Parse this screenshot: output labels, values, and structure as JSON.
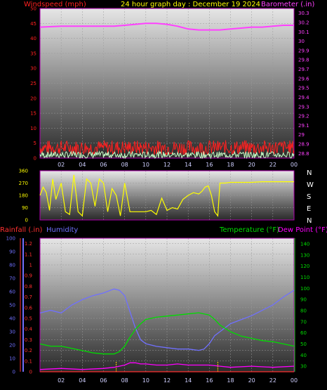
{
  "colors": {
    "wind": "#ff2020",
    "windAvg": "#c8ffc8",
    "barometer": "#ff40ff",
    "direction": "#ffff00",
    "rainfall": "#ff3030",
    "humidity": "#7070ff",
    "temperature": "#00dd00",
    "dewpoint": "#ff00ff",
    "title": "#ffff00"
  },
  "chart_data": [
    {
      "type": "line",
      "title": "24 hour graph day : December 19 2024",
      "ylabel_left": "Windspeed (mph)",
      "ylabel_right": "Barometer (.in)",
      "left_ticks": [
        "50",
        "45",
        "40",
        "35",
        "30",
        "25",
        "20",
        "15",
        "10",
        "5",
        "0"
      ],
      "right_ticks": [
        "30.3",
        "30.2",
        "30.1",
        "30",
        "29.9",
        "29.8",
        "29.7",
        "29.6",
        "29.5",
        "29.4",
        "29.3",
        "29.2",
        "29.1",
        "29",
        "28.9",
        "28.8"
      ],
      "x_ticks": [
        "02",
        "04",
        "06",
        "08",
        "10",
        "12",
        "14",
        "16",
        "18",
        "20",
        "22",
        "00"
      ],
      "ylim_left": [
        0,
        50
      ],
      "ylim_right": [
        28.75,
        30.35
      ],
      "grid": true,
      "series": [
        {
          "name": "Barometer (.in)",
          "axis": "right",
          "x": [
            0,
            2,
            4,
            6,
            7,
            8,
            9,
            10,
            11,
            12,
            13,
            14,
            15,
            16,
            17,
            18,
            19,
            20,
            21,
            22,
            23,
            24
          ],
          "values": [
            30.15,
            30.16,
            30.16,
            30.16,
            30.16,
            30.17,
            30.18,
            30.19,
            30.19,
            30.18,
            30.16,
            30.13,
            30.12,
            30.12,
            30.12,
            30.13,
            30.14,
            30.15,
            30.15,
            30.16,
            30.17,
            30.17
          ]
        }
      ]
    },
    {
      "type": "line",
      "ylabel_left": "",
      "left_ticks": [
        "360",
        "270",
        "180",
        "90",
        "0"
      ],
      "direction_labels": [
        "N",
        "W",
        "S",
        "E",
        "N"
      ],
      "ylim": [
        0,
        360
      ],
      "grid": true,
      "series": [
        {
          "x": [
            0,
            0.3,
            0.6,
            0.9,
            1.2,
            1.5,
            2.0,
            2.4,
            2.8,
            3.2,
            3.6,
            4.0,
            4.4,
            4.8,
            5.2,
            5.6,
            6.0,
            6.4,
            6.8,
            7.2,
            7.6,
            8.0,
            8.5,
            9.0,
            9.5,
            10.0,
            10.5,
            11.0,
            11.5,
            12.0,
            12.5,
            13.0,
            13.5,
            14.0,
            14.5,
            15.0,
            15.3,
            15.6,
            15.9,
            16.2,
            16.5,
            16.8,
            17.0,
            17.5,
            18.0,
            19.0,
            20.0,
            21.0,
            22.0,
            23.0,
            24.0
          ],
          "values": [
            180,
            240,
            200,
            70,
            300,
            150,
            270,
            60,
            40,
            330,
            60,
            30,
            300,
            270,
            100,
            300,
            270,
            60,
            230,
            180,
            30,
            270,
            60,
            60,
            60,
            60,
            70,
            40,
            160,
            70,
            90,
            80,
            150,
            180,
            200,
            190,
            210,
            240,
            250,
            180,
            60,
            30,
            270,
            270,
            275,
            275,
            275,
            280,
            280,
            280,
            280
          ]
        }
      ]
    },
    {
      "type": "line",
      "ylabel_left": "Rainfall (.in)",
      "ylabel_left2": "Humidity",
      "ylabel_right": "Temperature (°F)",
      "ylabel_right2": "Dew Point (°F)",
      "humidity_ticks": [
        "100",
        "90",
        "80",
        "70",
        "60",
        "50",
        "40",
        "30",
        "20",
        "10",
        "0"
      ],
      "rain_ticks": [
        "1.2",
        "1.1",
        "1",
        "0.9",
        "0.8",
        "0.7",
        "0.6",
        "0.5",
        "0.4",
        "0.3",
        "0.2",
        "0.1",
        "0"
      ],
      "temp_ticks": [
        "140",
        "130",
        "120",
        "110",
        "100",
        "90",
        "80",
        "70",
        "60",
        "50",
        "40",
        "30"
      ],
      "x_ticks": [
        "02",
        "04",
        "06",
        "08",
        "10",
        "12",
        "14",
        "16",
        "18",
        "20",
        "22",
        "00"
      ],
      "ylim_humidity": [
        0,
        100
      ],
      "ylim_temperature": [
        25,
        145
      ],
      "grid": true,
      "series": [
        {
          "name": "Humidity",
          "axis": "humidity",
          "x": [
            0,
            1,
            2,
            3,
            4,
            5,
            6,
            7,
            7.5,
            8,
            8.5,
            9,
            9.5,
            10,
            11,
            12,
            13,
            14,
            15,
            15.5,
            16,
            16.5,
            17,
            18,
            19,
            20,
            21,
            22,
            23,
            24
          ],
          "values": [
            44,
            46,
            44,
            50,
            54,
            57,
            59,
            62,
            61,
            57,
            45,
            33,
            24,
            21,
            19,
            18,
            17,
            17,
            16,
            17,
            21,
            27,
            30,
            36,
            39,
            42,
            46,
            50,
            56,
            61
          ]
        },
        {
          "name": "Temperature (°F)",
          "axis": "temperature",
          "x": [
            0,
            1,
            2,
            3,
            4,
            5,
            6,
            7,
            7.5,
            8,
            8.5,
            9,
            9.5,
            10,
            11,
            12,
            13,
            14,
            15,
            15.5,
            16,
            16.5,
            17,
            18,
            19,
            20,
            21,
            22,
            23,
            24
          ],
          "values": [
            50,
            48,
            48,
            46,
            44,
            42,
            41,
            41,
            43,
            48,
            56,
            63,
            68,
            72,
            74,
            75,
            76,
            77,
            78,
            77,
            76,
            72,
            67,
            61,
            57,
            55,
            53,
            52,
            50,
            48
          ]
        },
        {
          "name": "Dew Point (°F)",
          "axis": "temperature",
          "x": [
            0,
            2,
            4,
            6,
            7,
            8,
            8.5,
            9,
            9.5,
            10,
            11,
            12,
            13,
            14,
            15,
            16,
            17,
            18,
            20,
            22,
            24
          ],
          "values": [
            27,
            28,
            27,
            28,
            29,
            31,
            33,
            33,
            32,
            32,
            31,
            31,
            32,
            31,
            31,
            31,
            30,
            29,
            30,
            29,
            30
          ]
        },
        {
          "name": "Rainfall (.in)",
          "axis": "rain",
          "x": [
            0,
            24
          ],
          "values": [
            0,
            0
          ]
        }
      ]
    }
  ]
}
